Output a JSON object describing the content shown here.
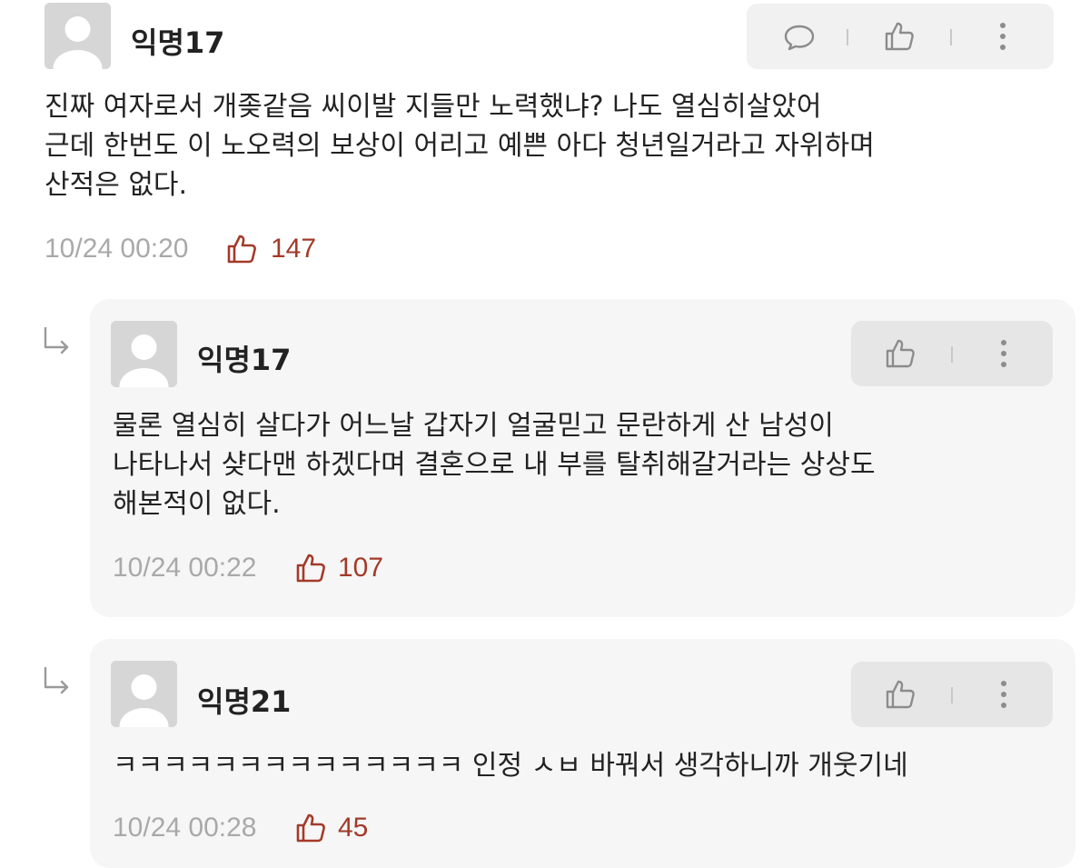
{
  "comments": [
    {
      "author": "익명17",
      "body": "진짜 여자로서 개좆같음 씨이발 지들만 노력했냐? 나도 열심히살았어\n근데 한번도 이 노오력의 보상이 어리고 예쁜 아다 청년일거라고 자위하며\n산적은 없다.",
      "timestamp": "10/24 00:20",
      "likes": "147",
      "actions": [
        "comment-icon",
        "thumbs-up-icon",
        "more-vertical-icon"
      ]
    },
    {
      "author": "익명17",
      "body": "물론 열심히 살다가 어느날 갑자기 얼굴믿고 문란하게 산 남성이\n나타나서 샺다맨 하겠다며 결혼으로 내 부를 탈취해갈거라는 상상도\n해본적이 없다.",
      "timestamp": "10/24 00:22",
      "likes": "107",
      "actions": [
        "thumbs-up-icon",
        "more-vertical-icon"
      ]
    },
    {
      "author": "익명21",
      "body": "ㅋㅋㅋㅋㅋㅋㅋㅋㅋㅋㅋㅋㅋㅋ 인정 ㅅㅂ 바꿔서 생각하니까 개웃기네",
      "timestamp": "10/24 00:28",
      "likes": "45",
      "actions": [
        "thumbs-up-icon",
        "more-vertical-icon"
      ]
    }
  ],
  "colors": {
    "text": "#222222",
    "meta": "#a9a9a9",
    "like_accent": "#a33a2a",
    "reply_bg": "#f6f6f6",
    "action_bg": "#f1f1f1",
    "avatar_bg": "#d6d6d6"
  }
}
